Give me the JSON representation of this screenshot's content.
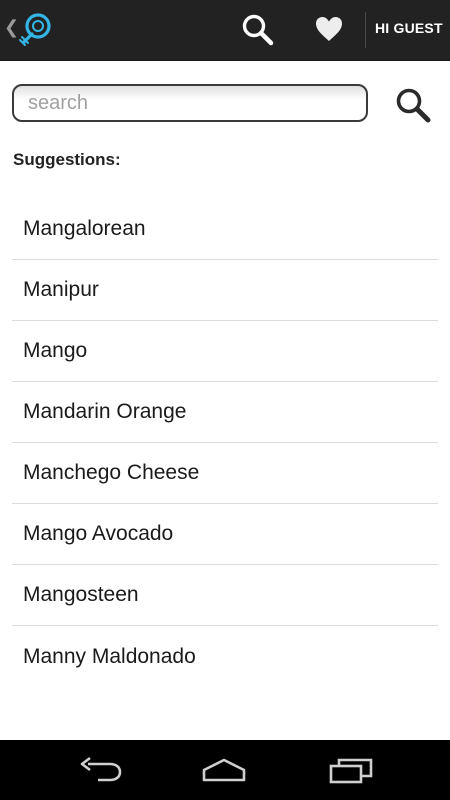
{
  "topbar": {
    "back_icon": "chevron-left-icon",
    "logo_icon": "lightbulb-logo-icon",
    "search_icon": "search-icon",
    "favorites_icon": "heart-icon",
    "user_label": "HI GUEST",
    "background": "#222222",
    "logo_color": "#33b5e5"
  },
  "search": {
    "placeholder": "search",
    "value": "",
    "button_icon": "search-icon"
  },
  "suggestions": {
    "heading": "Suggestions:",
    "items": [
      {
        "label": "Mangalorean"
      },
      {
        "label": "Manipur"
      },
      {
        "label": "Mango"
      },
      {
        "label": "Mandarin Orange"
      },
      {
        "label": "Manchego Cheese"
      },
      {
        "label": "Mango Avocado"
      },
      {
        "label": "Mangosteen"
      },
      {
        "label": "Manny Maldonado"
      }
    ]
  },
  "navbar": {
    "back_icon": "back-arrow-icon",
    "home_icon": "home-icon",
    "recents_icon": "recent-apps-icon"
  }
}
